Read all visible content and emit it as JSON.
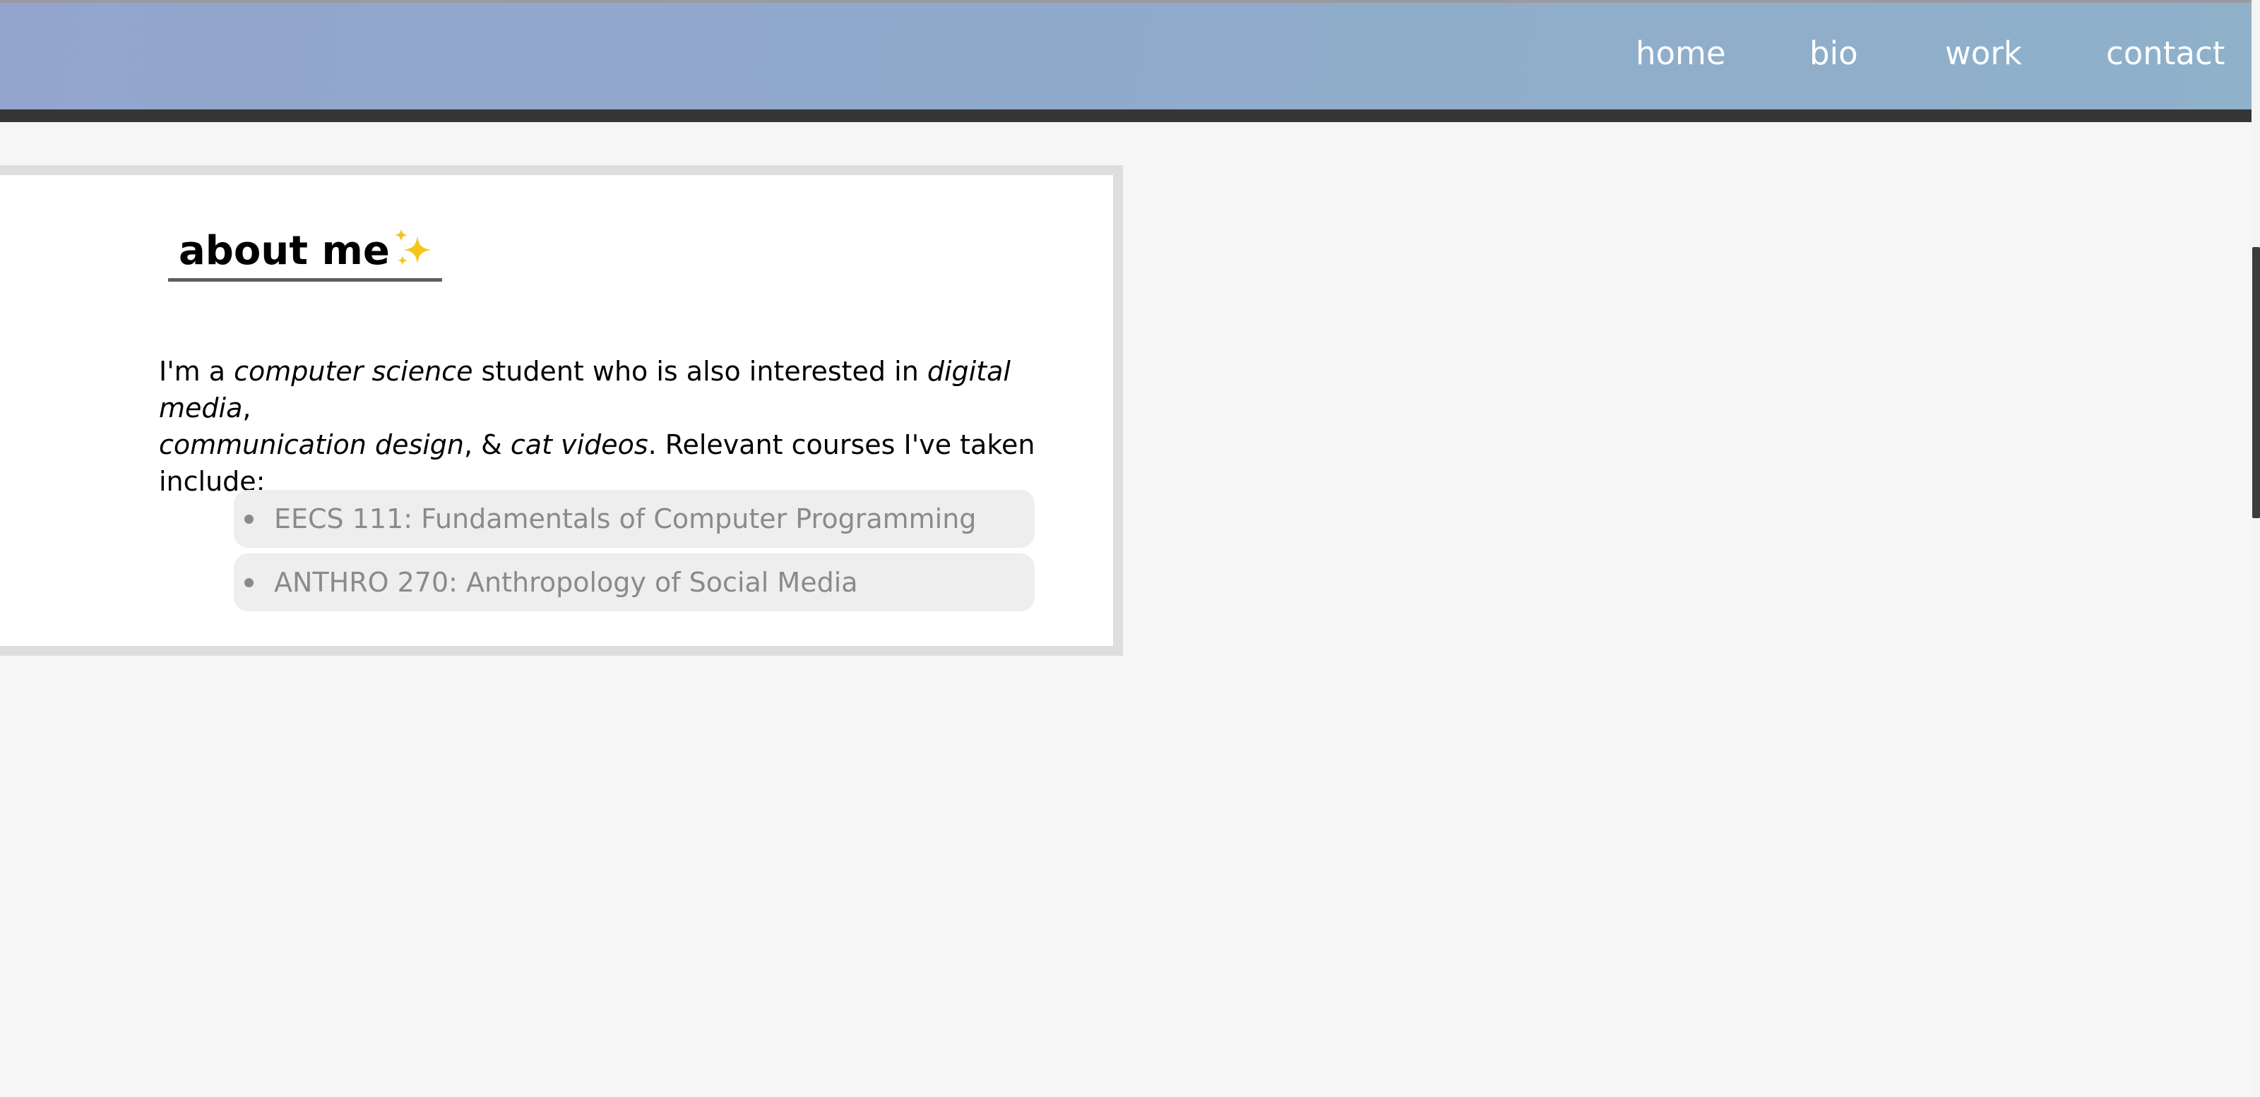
{
  "nav": {
    "links": [
      "home",
      "bio",
      "work",
      "contact"
    ]
  },
  "about": {
    "title": "about me",
    "emoji_icon": "sparkles-icon",
    "intro": {
      "prefix": "I'm a ",
      "topic_1": "computer science",
      "mid_1": " student who is also interested in ",
      "topic_2": "digital media",
      "mid_2": ", ",
      "topic_3": "communication design",
      "mid_3": ", & ",
      "topic_4": "cat videos",
      "suffix": ". Relevant courses I've taken include:"
    },
    "courses": [
      "EECS 111: Fundamentals of Computer Programming",
      "ANTHRO 270: Anthropology of Social Media"
    ]
  },
  "colors": {
    "nav_gradient_start": "#93a5cd",
    "nav_gradient_end": "#8fb1ca",
    "nav_bottom_bar": "#363636",
    "card_border": "#dedede",
    "course_bg": "#eeeeee",
    "course_text": "#8a8a8a",
    "sparkle": "#f5c518"
  }
}
